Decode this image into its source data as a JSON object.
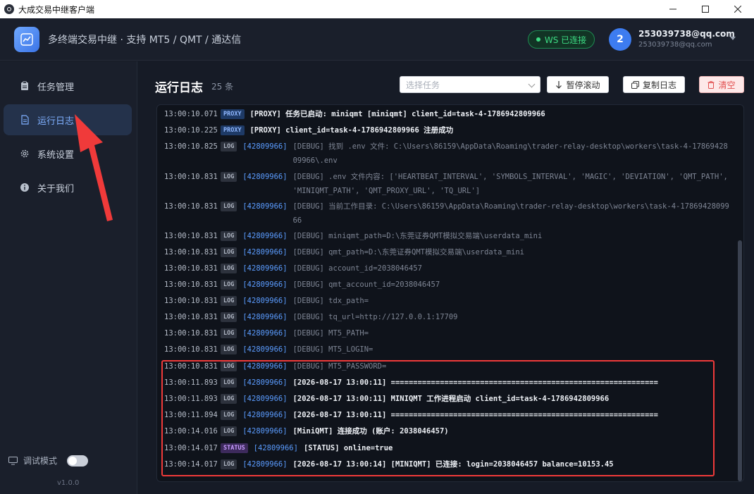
{
  "window": {
    "title": "大成交易中继客户端"
  },
  "header": {
    "subtitle": "多终端交易中继 · 支持 MT5 / QMT / 通达信",
    "ws_status": "WS 已连接",
    "avatar_text": "2",
    "user_name": "253039738@qq.com",
    "user_email": "253039738@qq.com"
  },
  "sidebar": {
    "items": [
      {
        "label": "任务管理",
        "icon": "clipboard-icon"
      },
      {
        "label": "运行日志",
        "icon": "document-icon"
      },
      {
        "label": "系统设置",
        "icon": "gear-icon"
      },
      {
        "label": "关于我们",
        "icon": "info-icon"
      }
    ],
    "debug_label": "调试模式",
    "version": "v1.0.0"
  },
  "main": {
    "title": "运行日志",
    "count": "25 条",
    "task_placeholder": "选择任务",
    "pause_label": "暂停滚动",
    "copy_label": "复制日志",
    "clear_label": "清空"
  },
  "logs": [
    {
      "ts": "13:00:10.071",
      "tag": "PROXY",
      "tid": "",
      "msg": "[PROXY] 任务已启动: miniqmt [miniqmt] client_id=task-4-1786942809966",
      "style": "bright"
    },
    {
      "ts": "13:00:10.225",
      "tag": "PROXY",
      "tid": "",
      "msg": "[PROXY] client_id=task-4-1786942809966 注册成功",
      "style": "bright"
    },
    {
      "ts": "13:00:10.825",
      "tag": "LOG",
      "tid": "[42809966]",
      "msg": "[DEBUG] 找到 .env 文件: C:\\Users\\86159\\AppData\\Roaming\\trader-relay-desktop\\workers\\task-4-1786942809966\\.env",
      "style": "dim"
    },
    {
      "ts": "13:00:10.831",
      "tag": "LOG",
      "tid": "[42809966]",
      "msg": "[DEBUG] .env 文件内容: ['HEARTBEAT_INTERVAL', 'SYMBOLS_INTERVAL', 'MAGIC', 'DEVIATION', 'QMT_PATH', 'MINIQMT_PATH', 'QMT_PROXY_URL', 'TQ_URL']",
      "style": "dim"
    },
    {
      "ts": "13:00:10.831",
      "tag": "LOG",
      "tid": "[42809966]",
      "msg": "[DEBUG] 当前工作目录: C:\\Users\\86159\\AppData\\Roaming\\trader-relay-desktop\\workers\\task-4-1786942809966",
      "style": "dim"
    },
    {
      "ts": "13:00:10.831",
      "tag": "LOG",
      "tid": "[42809966]",
      "msg": "[DEBUG] miniqmt_path=D:\\东莞证券QMT模拟交易端\\userdata_mini",
      "style": "dim"
    },
    {
      "ts": "13:00:10.831",
      "tag": "LOG",
      "tid": "[42809966]",
      "msg": "[DEBUG] qmt_path=D:\\东莞证券QMT模拟交易端\\userdata_mini",
      "style": "dim"
    },
    {
      "ts": "13:00:10.831",
      "tag": "LOG",
      "tid": "[42809966]",
      "msg": "[DEBUG] account_id=2038046457",
      "style": "dim"
    },
    {
      "ts": "13:00:10.831",
      "tag": "LOG",
      "tid": "[42809966]",
      "msg": "[DEBUG] qmt_account_id=2038046457",
      "style": "dim"
    },
    {
      "ts": "13:00:10.831",
      "tag": "LOG",
      "tid": "[42809966]",
      "msg": "[DEBUG] tdx_path=",
      "style": "dim"
    },
    {
      "ts": "13:00:10.831",
      "tag": "LOG",
      "tid": "[42809966]",
      "msg": "[DEBUG] tq_url=http://127.0.0.1:17709",
      "style": "dim"
    },
    {
      "ts": "13:00:10.831",
      "tag": "LOG",
      "tid": "[42809966]",
      "msg": "[DEBUG] MT5_PATH=",
      "style": "dim"
    },
    {
      "ts": "13:00:10.831",
      "tag": "LOG",
      "tid": "[42809966]",
      "msg": "[DEBUG] MT5_LOGIN=",
      "style": "dim"
    },
    {
      "ts": "13:00:10.831",
      "tag": "LOG",
      "tid": "[42809966]",
      "msg": "[DEBUG] MT5_PASSWORD=",
      "style": "dim"
    },
    {
      "ts": "13:00:11.893",
      "tag": "LOG",
      "tid": "[42809966]",
      "msg": "[2026-08-17 13:00:11] ============================================================",
      "style": "bright"
    },
    {
      "ts": "13:00:11.893",
      "tag": "LOG",
      "tid": "[42809966]",
      "msg": "[2026-08-17 13:00:11] MINIQMT 工作进程启动 client_id=task-4-1786942809966",
      "style": "bright"
    },
    {
      "ts": "13:00:11.894",
      "tag": "LOG",
      "tid": "[42809966]",
      "msg": "[2026-08-17 13:00:11] ============================================================",
      "style": "bright"
    },
    {
      "ts": "13:00:14.016",
      "tag": "LOG",
      "tid": "[42809966]",
      "msg": "[MiniQMT] 连接成功 (账户: 2038046457)",
      "style": "bright"
    },
    {
      "ts": "13:00:14.017",
      "tag": "STATUS",
      "tid": "[42809966]",
      "msg": "[STATUS] online=true",
      "style": "bright"
    },
    {
      "ts": "13:00:14.017",
      "tag": "LOG",
      "tid": "[42809966]",
      "msg": "[2026-08-17 13:00:14] [MINIQMT] 已连接: login=2038046457 balance=10153.45",
      "style": "bright"
    }
  ]
}
